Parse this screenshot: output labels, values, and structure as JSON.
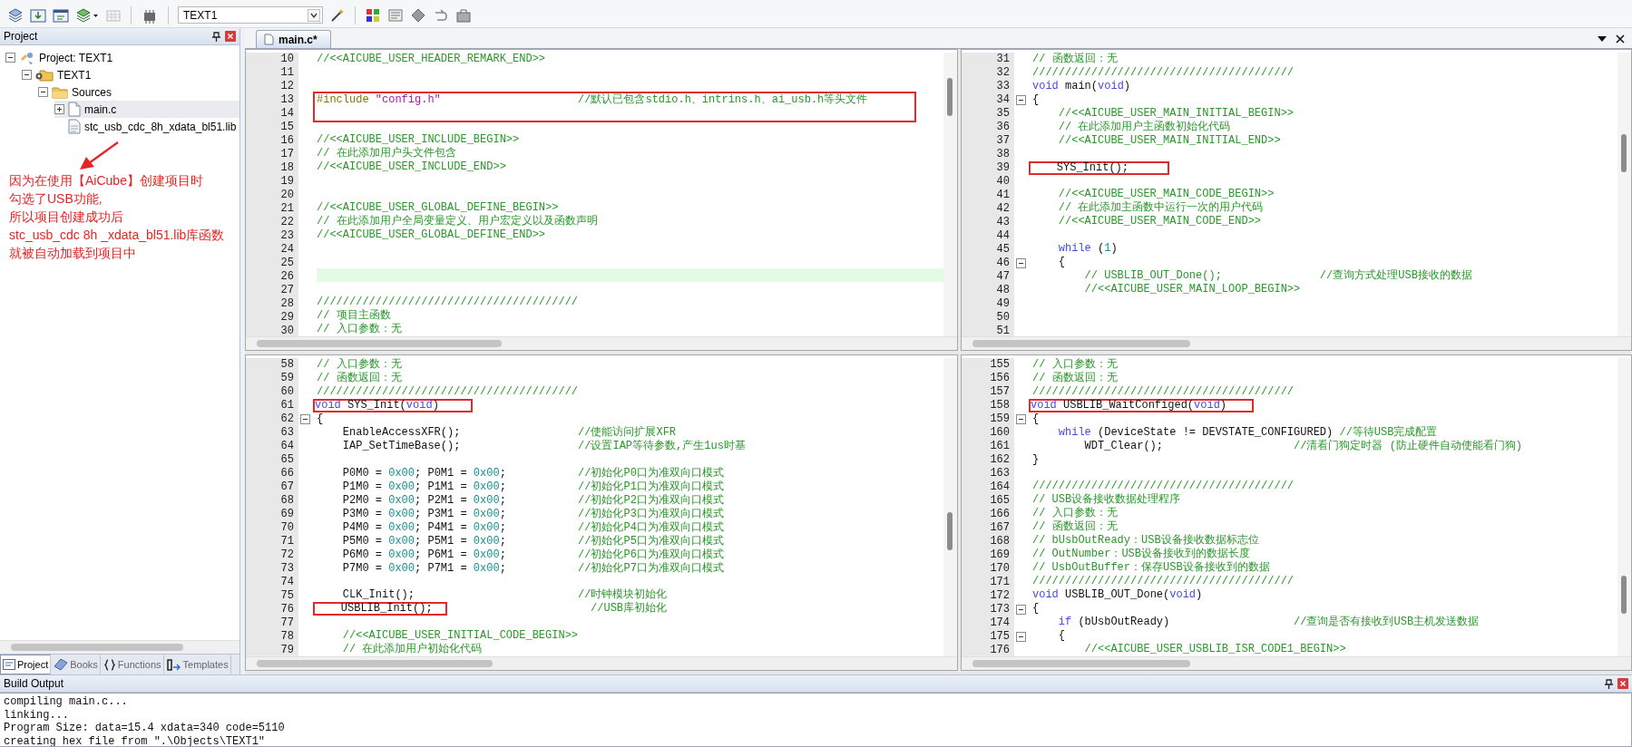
{
  "toolbar": {
    "target": "TEXT1"
  },
  "project_panel": {
    "title": "Project",
    "tree": [
      {
        "label": "Project: TEXT1",
        "kind": "project",
        "expanded": true,
        "selected": false,
        "children": [
          {
            "label": "TEXT1",
            "kind": "target",
            "expanded": true,
            "selected": false,
            "children": [
              {
                "label": "Sources",
                "kind": "folder",
                "expanded": true,
                "selected": false,
                "children": [
                  {
                    "label": "main.c",
                    "kind": "file",
                    "expanded": false,
                    "selected": true
                  },
                  {
                    "label": "stc_usb_cdc_8h_xdata_bl51.lib",
                    "kind": "library",
                    "selected": false
                  }
                ]
              }
            ]
          }
        ]
      }
    ],
    "annotation": [
      "因为在使用【AiCube】创建项目时",
      "勾选了USB功能,",
      "所以项目创建成功后",
      "stc_usb_cdc 8h _xdata_bl51.lib库函数",
      "就被自动加载到项目中"
    ],
    "tabs": [
      {
        "label": "Project",
        "kind": "project",
        "selected": true
      },
      {
        "label": "Books",
        "kind": "books",
        "selected": false
      },
      {
        "label": "Functions",
        "kind": "functions",
        "selected": false
      },
      {
        "label": "Templates",
        "kind": "templates",
        "selected": false
      }
    ]
  },
  "editor": {
    "tabs": [
      {
        "label": "main.c*",
        "selected": true
      }
    ],
    "panes": [
      {
        "lines": [
          {
            "n": "10",
            "code": [
              {
                "kind": "comment",
                "text": "//<<AICUBE_USER_HEADER_REMARK_END>>"
              }
            ]
          },
          {
            "n": "11"
          },
          {
            "n": "12"
          },
          {
            "n": "13",
            "boxed": true,
            "code": [
              {
                "kind": "preprocessor",
                "text": "#include "
              },
              {
                "kind": "string",
                "text": "\"config.h\""
              },
              {
                "kind": "comment",
                "text": "                     //默认已包含stdio.h、intrins.h、ai_usb.h等头文件"
              }
            ]
          },
          {
            "n": "14",
            "boxed": true
          },
          {
            "n": "15"
          },
          {
            "n": "16",
            "code": [
              {
                "kind": "comment",
                "text": "//<<AICUBE_USER_INCLUDE_BEGIN>>"
              }
            ]
          },
          {
            "n": "17",
            "code": [
              {
                "kind": "comment",
                "text": "// 在此添加用户头文件包含"
              }
            ]
          },
          {
            "n": "18",
            "code": [
              {
                "kind": "comment",
                "text": "//<<AICUBE_USER_INCLUDE_END>>"
              }
            ]
          },
          {
            "n": "19"
          },
          {
            "n": "20"
          },
          {
            "n": "21",
            "code": [
              {
                "kind": "comment",
                "text": "//<<AICUBE_USER_GLOBAL_DEFINE_BEGIN>>"
              }
            ]
          },
          {
            "n": "22",
            "code": [
              {
                "kind": "comment",
                "text": "// 在此添加用户全局变量定义、用户宏定义以及函数声明"
              }
            ]
          },
          {
            "n": "23",
            "code": [
              {
                "kind": "comment",
                "text": "//<<AICUBE_USER_GLOBAL_DEFINE_END>>"
              }
            ]
          },
          {
            "n": "24"
          },
          {
            "n": "25"
          },
          {
            "n": "26",
            "current": true
          },
          {
            "n": "27"
          },
          {
            "n": "28",
            "code": [
              {
                "kind": "comment",
                "text": "////////////////////////////////////////"
              }
            ]
          },
          {
            "n": "29",
            "code": [
              {
                "kind": "comment",
                "text": "// 项目主函数"
              }
            ]
          },
          {
            "n": "30",
            "code": [
              {
                "kind": "comment",
                "text": "// 入口参数：无"
              }
            ]
          }
        ]
      },
      {
        "lines": [
          {
            "n": "31",
            "code": [
              {
                "kind": "comment",
                "text": "// 函数返回：无"
              }
            ]
          },
          {
            "n": "32",
            "code": [
              {
                "kind": "comment",
                "text": "////////////////////////////////////////"
              }
            ]
          },
          {
            "n": "33",
            "code": [
              {
                "kind": "keyword",
                "text": "void"
              },
              {
                "kind": "plain",
                "text": " main("
              },
              {
                "kind": "keyword",
                "text": "void"
              },
              {
                "kind": "plain",
                "text": ")"
              }
            ]
          },
          {
            "n": "34",
            "expanded": true,
            "code": [
              {
                "kind": "plain",
                "text": "{"
              }
            ]
          },
          {
            "n": "35",
            "code": [
              {
                "kind": "comment",
                "text": "    //<<AICUBE_USER_MAIN_INITIAL_BEGIN>>"
              }
            ]
          },
          {
            "n": "36",
            "code": [
              {
                "kind": "comment",
                "text": "    // 在此添加用户主函数初始化代码"
              }
            ]
          },
          {
            "n": "37",
            "code": [
              {
                "kind": "comment",
                "text": "    //<<AICUBE_USER_MAIN_INITIAL_END>>"
              }
            ]
          },
          {
            "n": "38"
          },
          {
            "n": "39",
            "boxed": true,
            "code": [
              {
                "kind": "plain",
                "text": "    SYS_Init();    "
              }
            ]
          },
          {
            "n": "40"
          },
          {
            "n": "41",
            "code": [
              {
                "kind": "comment",
                "text": "    //<<AICUBE_USER_MAIN_CODE_BEGIN>>"
              }
            ]
          },
          {
            "n": "42",
            "code": [
              {
                "kind": "comment",
                "text": "    // 在此添加主函数中运行一次的用户代码"
              }
            ]
          },
          {
            "n": "43",
            "code": [
              {
                "kind": "comment",
                "text": "    //<<AICUBE_USER_MAIN_CODE_END>>"
              }
            ]
          },
          {
            "n": "44"
          },
          {
            "n": "45",
            "code": [
              {
                "kind": "keyword",
                "text": "    while"
              },
              {
                "kind": "plain",
                "text": " ("
              },
              {
                "kind": "number",
                "text": "1"
              },
              {
                "kind": "plain",
                "text": ")"
              }
            ]
          },
          {
            "n": "46",
            "expanded": true,
            "code": [
              {
                "kind": "plain",
                "text": "    {"
              }
            ]
          },
          {
            "n": "47",
            "code": [
              {
                "kind": "comment",
                "text": "        // USBLIB_OUT_Done();"
              },
              {
                "kind": "comment",
                "text": "               //查询方式处理USB接收的数据"
              }
            ]
          },
          {
            "n": "48",
            "code": [
              {
                "kind": "comment",
                "text": "        //<<AICUBE_USER_MAIN_LOOP_BEGIN>>"
              }
            ]
          },
          {
            "n": "49"
          },
          {
            "n": "50"
          },
          {
            "n": "51"
          }
        ]
      },
      {
        "lines": [
          {
            "n": "58",
            "code": [
              {
                "kind": "comment",
                "text": "// 入口参数：无"
              }
            ]
          },
          {
            "n": "59",
            "code": [
              {
                "kind": "comment",
                "text": "// 函数返回：无"
              }
            ]
          },
          {
            "n": "60",
            "code": [
              {
                "kind": "comment",
                "text": "////////////////////////////////////////"
              }
            ]
          },
          {
            "n": "61",
            "boxed": true,
            "code": [
              {
                "kind": "keyword",
                "text": "void"
              },
              {
                "kind": "plain",
                "text": " SYS_Init("
              },
              {
                "kind": "keyword",
                "text": "void"
              },
              {
                "kind": "plain",
                "text": ")   "
              }
            ]
          },
          {
            "n": "62",
            "expanded": true,
            "code": [
              {
                "kind": "plain",
                "text": "{"
              }
            ]
          },
          {
            "n": "63",
            "code": [
              {
                "kind": "plain",
                "text": "    EnableAccessXFR();"
              },
              {
                "kind": "comment",
                "text": "                  //使能访问扩展XFR"
              }
            ]
          },
          {
            "n": "64",
            "code": [
              {
                "kind": "plain",
                "text": "    IAP_SetTimeBase();"
              },
              {
                "kind": "comment",
                "text": "                  //设置IAP等待参数,产生1us时基"
              }
            ]
          },
          {
            "n": "65"
          },
          {
            "n": "66",
            "code": [
              {
                "kind": "plain",
                "text": "    P0M0 = "
              },
              {
                "kind": "number",
                "text": "0x00"
              },
              {
                "kind": "plain",
                "text": "; P0M1 = "
              },
              {
                "kind": "number",
                "text": "0x00"
              },
              {
                "kind": "plain",
                "text": ";"
              },
              {
                "kind": "comment",
                "text": "           //初始化P0口为准双向口模式"
              }
            ]
          },
          {
            "n": "67",
            "code": [
              {
                "kind": "plain",
                "text": "    P1M0 = "
              },
              {
                "kind": "number",
                "text": "0x00"
              },
              {
                "kind": "plain",
                "text": "; P1M1 = "
              },
              {
                "kind": "number",
                "text": "0x00"
              },
              {
                "kind": "plain",
                "text": ";"
              },
              {
                "kind": "comment",
                "text": "           //初始化P1口为准双向口模式"
              }
            ]
          },
          {
            "n": "68",
            "code": [
              {
                "kind": "plain",
                "text": "    P2M0 = "
              },
              {
                "kind": "number",
                "text": "0x00"
              },
              {
                "kind": "plain",
                "text": "; P2M1 = "
              },
              {
                "kind": "number",
                "text": "0x00"
              },
              {
                "kind": "plain",
                "text": ";"
              },
              {
                "kind": "comment",
                "text": "           //初始化P2口为准双向口模式"
              }
            ]
          },
          {
            "n": "69",
            "code": [
              {
                "kind": "plain",
                "text": "    P3M0 = "
              },
              {
                "kind": "number",
                "text": "0x00"
              },
              {
                "kind": "plain",
                "text": "; P3M1 = "
              },
              {
                "kind": "number",
                "text": "0x00"
              },
              {
                "kind": "plain",
                "text": ";"
              },
              {
                "kind": "comment",
                "text": "           //初始化P3口为准双向口模式"
              }
            ]
          },
          {
            "n": "70",
            "code": [
              {
                "kind": "plain",
                "text": "    P4M0 = "
              },
              {
                "kind": "number",
                "text": "0x00"
              },
              {
                "kind": "plain",
                "text": "; P4M1 = "
              },
              {
                "kind": "number",
                "text": "0x00"
              },
              {
                "kind": "plain",
                "text": ";"
              },
              {
                "kind": "comment",
                "text": "           //初始化P4口为准双向口模式"
              }
            ]
          },
          {
            "n": "71",
            "code": [
              {
                "kind": "plain",
                "text": "    P5M0 = "
              },
              {
                "kind": "number",
                "text": "0x00"
              },
              {
                "kind": "plain",
                "text": "; P5M1 = "
              },
              {
                "kind": "number",
                "text": "0x00"
              },
              {
                "kind": "plain",
                "text": ";"
              },
              {
                "kind": "comment",
                "text": "           //初始化P5口为准双向口模式"
              }
            ]
          },
          {
            "n": "72",
            "code": [
              {
                "kind": "plain",
                "text": "    P6M0 = "
              },
              {
                "kind": "number",
                "text": "0x00"
              },
              {
                "kind": "plain",
                "text": "; P6M1 = "
              },
              {
                "kind": "number",
                "text": "0x00"
              },
              {
                "kind": "plain",
                "text": ";"
              },
              {
                "kind": "comment",
                "text": "           //初始化P6口为准双向口模式"
              }
            ]
          },
          {
            "n": "73",
            "code": [
              {
                "kind": "plain",
                "text": "    P7M0 = "
              },
              {
                "kind": "number",
                "text": "0x00"
              },
              {
                "kind": "plain",
                "text": "; P7M1 = "
              },
              {
                "kind": "number",
                "text": "0x00"
              },
              {
                "kind": "plain",
                "text": ";"
              },
              {
                "kind": "comment",
                "text": "           //初始化P7口为准双向口模式"
              }
            ]
          },
          {
            "n": "74"
          },
          {
            "n": "75",
            "code": [
              {
                "kind": "plain",
                "text": "    CLK_Init();"
              },
              {
                "kind": "comment",
                "text": "                         //时钟模块初始化"
              }
            ]
          },
          {
            "n": "76",
            "boxed": true,
            "code": [
              {
                "kind": "plain",
                "text": "    USBLIB_Init();"
              },
              {
                "kind": "comment",
                "text": "                      //USB库初始化"
              }
            ]
          },
          {
            "n": "77"
          },
          {
            "n": "78",
            "code": [
              {
                "kind": "comment",
                "text": "    //<<AICUBE_USER_INITIAL_CODE_BEGIN>>"
              }
            ]
          },
          {
            "n": "79",
            "code": [
              {
                "kind": "comment",
                "text": "    // 在此添加用户初始化代码"
              }
            ]
          }
        ]
      },
      {
        "lines": [
          {
            "n": "155",
            "code": [
              {
                "kind": "comment",
                "text": "// 入口参数：无"
              }
            ]
          },
          {
            "n": "156",
            "code": [
              {
                "kind": "comment",
                "text": "// 函数返回：无"
              }
            ]
          },
          {
            "n": "157",
            "code": [
              {
                "kind": "comment",
                "text": "////////////////////////////////////////"
              }
            ]
          },
          {
            "n": "158",
            "boxed": true,
            "code": [
              {
                "kind": "keyword",
                "text": "void"
              },
              {
                "kind": "plain",
                "text": " USBLIB_WaitConfiged("
              },
              {
                "kind": "keyword",
                "text": "void"
              },
              {
                "kind": "plain",
                "text": ")  "
              }
            ]
          },
          {
            "n": "159",
            "expanded": true,
            "code": [
              {
                "kind": "plain",
                "text": "{"
              }
            ]
          },
          {
            "n": "160",
            "code": [
              {
                "kind": "keyword",
                "text": "    while"
              },
              {
                "kind": "plain",
                "text": " (DeviceState != DEVSTATE_CONFIGURED) "
              },
              {
                "kind": "comment",
                "text": "//等待USB完成配置"
              }
            ]
          },
          {
            "n": "161",
            "code": [
              {
                "kind": "plain",
                "text": "        WDT_Clear();"
              },
              {
                "kind": "comment",
                "text": "                    //清看门狗定时器 (防止硬件自动使能看门狗)"
              }
            ]
          },
          {
            "n": "162",
            "code": [
              {
                "kind": "plain",
                "text": "}"
              }
            ]
          },
          {
            "n": "163"
          },
          {
            "n": "164",
            "code": [
              {
                "kind": "comment",
                "text": "////////////////////////////////////////"
              }
            ]
          },
          {
            "n": "165",
            "code": [
              {
                "kind": "comment",
                "text": "// USB设备接收数据处理程序"
              }
            ]
          },
          {
            "n": "166",
            "code": [
              {
                "kind": "comment",
                "text": "// 入口参数：无"
              }
            ]
          },
          {
            "n": "167",
            "code": [
              {
                "kind": "comment",
                "text": "// 函数返回：无"
              }
            ]
          },
          {
            "n": "168",
            "code": [
              {
                "kind": "comment",
                "text": "// bUsbOutReady：USB设备接收数据标志位"
              }
            ]
          },
          {
            "n": "169",
            "code": [
              {
                "kind": "comment",
                "text": "// OutNumber：USB设备接收到的数据长度"
              }
            ]
          },
          {
            "n": "170",
            "code": [
              {
                "kind": "comment",
                "text": "// UsbOutBuffer：保存USB设备接收到的数据"
              }
            ]
          },
          {
            "n": "171",
            "code": [
              {
                "kind": "comment",
                "text": "////////////////////////////////////////"
              }
            ]
          },
          {
            "n": "172",
            "code": [
              {
                "kind": "keyword",
                "text": "void"
              },
              {
                "kind": "plain",
                "text": " USBLIB_OUT_Done("
              },
              {
                "kind": "keyword",
                "text": "void"
              },
              {
                "kind": "plain",
                "text": ")"
              }
            ]
          },
          {
            "n": "173",
            "expanded": true,
            "code": [
              {
                "kind": "plain",
                "text": "{"
              }
            ]
          },
          {
            "n": "174",
            "code": [
              {
                "kind": "keyword",
                "text": "    if"
              },
              {
                "kind": "plain",
                "text": " (bUsbOutReady)"
              },
              {
                "kind": "comment",
                "text": "                   //查询是否有接收到USB主机发送数据"
              }
            ]
          },
          {
            "n": "175",
            "expanded": true,
            "code": [
              {
                "kind": "plain",
                "text": "    {"
              }
            ]
          },
          {
            "n": "176",
            "code": [
              {
                "kind": "comment",
                "text": "        //<<AICUBE_USER_USBLIB_ISR_CODE1_BEGIN>>"
              }
            ]
          }
        ]
      }
    ]
  },
  "build_output": {
    "title": "Build Output",
    "lines": [
      "compiling main.c...",
      "linking...",
      "Program Size: data=15.4 xdata=340 code=5110",
      "creating hex file from \".\\Objects\\TEXT1\""
    ]
  }
}
